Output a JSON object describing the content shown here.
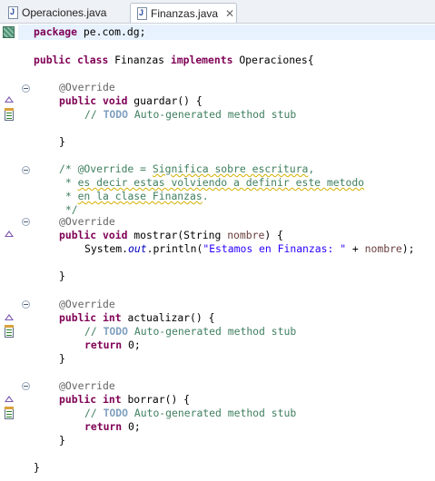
{
  "tabs": [
    {
      "label": "Operaciones.java",
      "active": false,
      "icon": "java-file-icon"
    },
    {
      "label": "Finanzas.java",
      "active": true,
      "icon": "java-file-icon",
      "close_icon": "close-icon"
    }
  ],
  "code": {
    "package_kw": "package",
    "package_name": " pe.com.dg;",
    "class_line": {
      "kw1": "public",
      "kw2": "class",
      "name": " Finanzas ",
      "kw3": "implements",
      "rest": " Operaciones{"
    },
    "override": "@Override",
    "guardar_sig": {
      "kw1": "public",
      "kw2": "void",
      "rest": " guardar() {"
    },
    "todo_prefix": "// ",
    "todo": "TODO",
    "todo_text": " Auto-generated method stub",
    "close_brace": "}",
    "comment": {
      "l1_pre": "/* @Override = ",
      "l1_sq": "Significa sobre escritura",
      "l1_post": ",",
      "l2_pre": " * ",
      "l2_sq": "es decir estas volviendo a definir este metodo",
      "l3_pre": " * ",
      "l3_sq": "en la clase Finanzas",
      "l3_post": ".",
      "l4": " */"
    },
    "mostrar_sig": {
      "kw1": "public",
      "kw2": "void",
      "rest1": " mostrar(String ",
      "param": "nombre",
      "rest2": ") {"
    },
    "println": {
      "pre": "System.",
      "field": "out",
      "mid": ".println(",
      "str": "\"Estamos en Finanzas: \"",
      "post": " + ",
      "param": "nombre",
      "end": ");"
    },
    "actualizar_sig": {
      "kw1": "public",
      "kw2": "int",
      "rest": " actualizar() {"
    },
    "borrar_sig": {
      "kw1": "public",
      "kw2": "int",
      "rest": " borrar() {"
    },
    "return_kw": "return",
    "return_val": " 0;",
    "class_close": "}"
  },
  "colors": {
    "keyword": "#7f0055",
    "comment": "#3f7f5f",
    "string": "#2a00ff",
    "annotation": "#646464",
    "field": "#0000c0",
    "current_line": "#e8f2fe"
  }
}
